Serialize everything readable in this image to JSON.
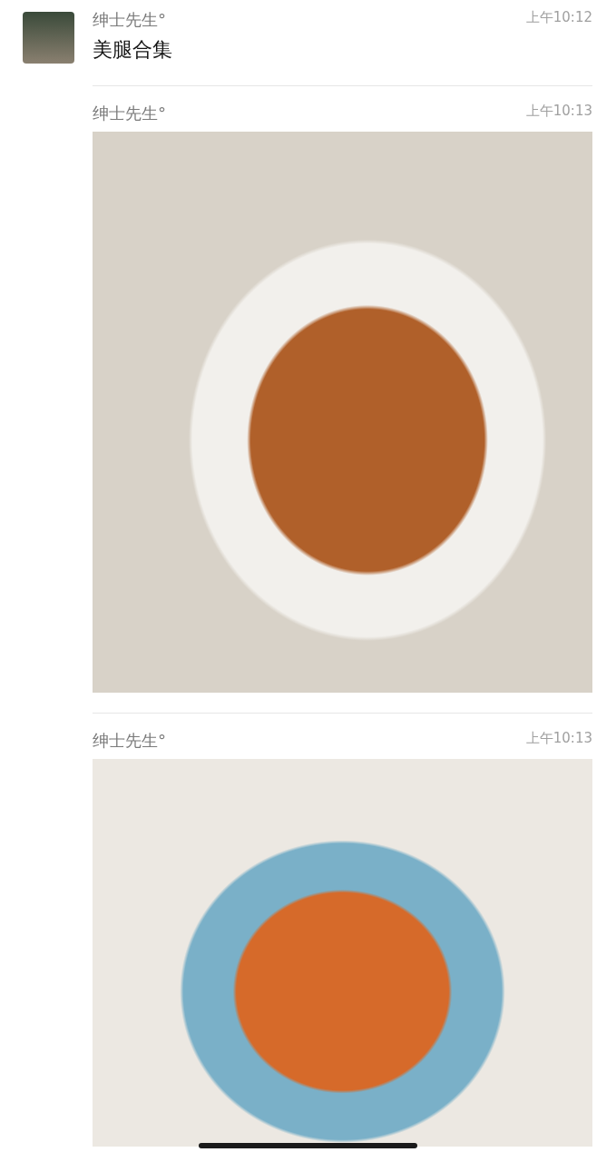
{
  "messages": [
    {
      "avatar": true,
      "sender": "绅士先生°",
      "time": "上午10:12",
      "kind": "text",
      "text": "美腿合集"
    },
    {
      "avatar": false,
      "sender": "绅士先生°",
      "time": "上午10:13",
      "kind": "image"
    },
    {
      "avatar": false,
      "sender": "绅士先生°",
      "time": "上午10:13",
      "kind": "image"
    }
  ]
}
